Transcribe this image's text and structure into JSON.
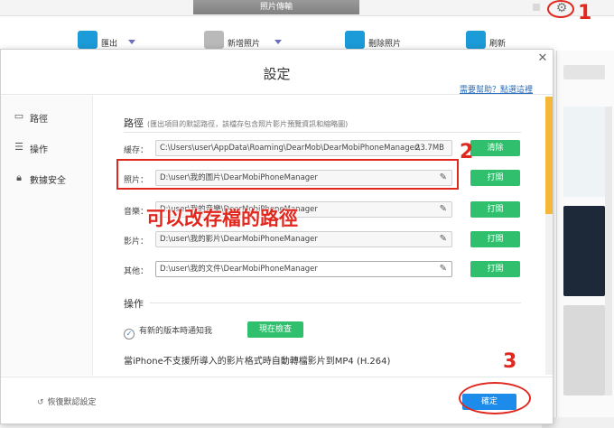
{
  "app": {
    "window_title": "照片傳輸"
  },
  "toolbar": {
    "items": [
      {
        "label": "匯出",
        "icon": "export-icon"
      },
      {
        "label": "新增照片",
        "icon": "add-photo-icon"
      },
      {
        "label": "刪除照片",
        "icon": "delete-photo-icon"
      },
      {
        "label": "刷新",
        "icon": "refresh-icon"
      }
    ]
  },
  "settings": {
    "title": "設定",
    "help_link": "需要幫助？點選這裡",
    "nav": [
      {
        "label": "路徑",
        "icon": "folder-icon"
      },
      {
        "label": "操作",
        "icon": "document-icon"
      },
      {
        "label": "數據安全",
        "icon": "lock-icon"
      }
    ],
    "path_section": {
      "title": "路徑",
      "hint": "(匯出項目的默認路徑，該檔存包含照片影片預覽資訊和縮略圖)",
      "rows": [
        {
          "label": "緩存：",
          "value": "C:\\Users\\user\\AppData\\Roaming\\DearMob\\DearMobiPhoneManager\\",
          "size": "23.7MB",
          "button": "清除"
        },
        {
          "label": "照片：",
          "value": "D:\\user\\我的圖片\\DearMobiPhoneManager",
          "button": "打開"
        },
        {
          "label": "音樂：",
          "value": "D:\\user\\我的音樂\\DearMobiPhoneManager",
          "button": "打開"
        },
        {
          "label": "影片：",
          "value": "D:\\user\\我的影片\\DearMobiPhoneManager",
          "button": "打開"
        },
        {
          "label": "其他：",
          "value": "D:\\user\\我的文件\\DearMobiPhoneManager",
          "button": "打開"
        }
      ]
    },
    "operation_section": {
      "title": "操作",
      "notify_label": "有新的版本時通知我",
      "notify_checked": true,
      "check_now_label": "現在檢查",
      "convert_note": "當iPhone不支援所導入的影片格式時自動轉檔影片到MP4 (H.264)"
    },
    "footer": {
      "restore_label": "恢復默認設定",
      "confirm_label": "確定"
    }
  },
  "annotations": {
    "caption": "可以改存檔的路徑",
    "numbers": [
      "1",
      "2",
      "3"
    ],
    "color": "#e0281f"
  },
  "colors": {
    "accent_green": "#2fbf6d",
    "accent_blue": "#1c8bea",
    "scroll_orange": "#f5b73a"
  }
}
